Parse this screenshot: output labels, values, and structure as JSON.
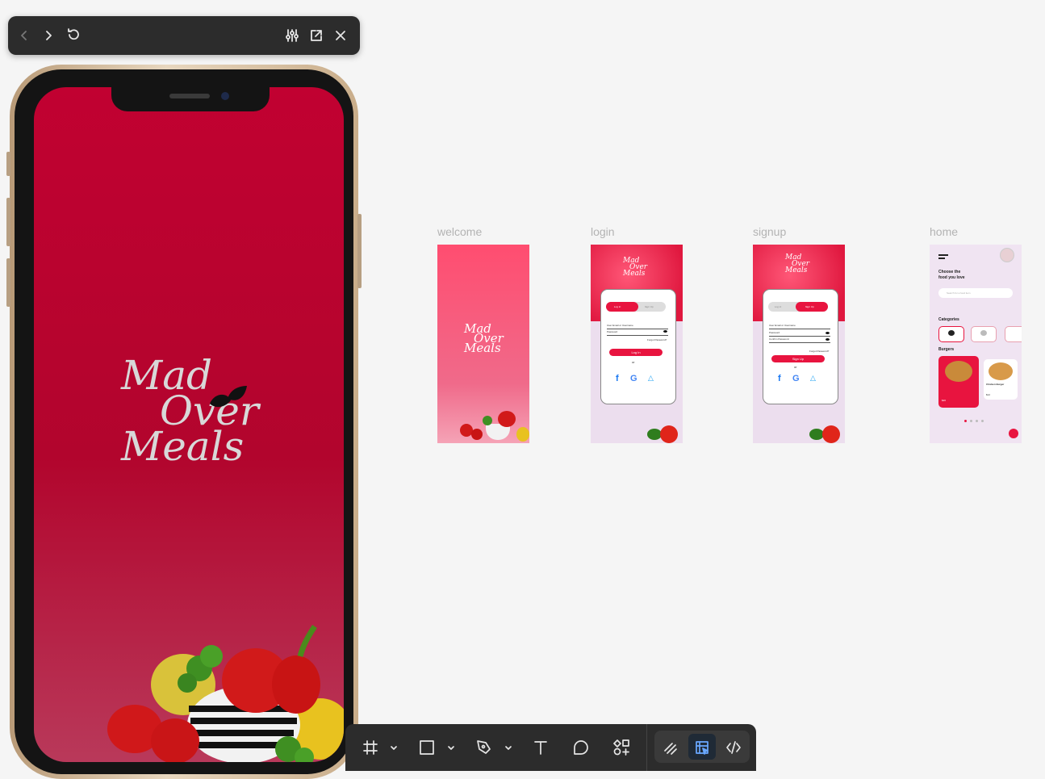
{
  "prototype_toolbar": {
    "back": "back-icon",
    "forward": "forward-icon",
    "restart": "restart-icon",
    "settings": "settings-icon",
    "open_new": "open-new-icon",
    "close": "close-icon"
  },
  "phone_preview": {
    "logo_line1": "Mad",
    "logo_line2": "Over",
    "logo_line3": "Meals"
  },
  "frames": [
    {
      "label": "welcome"
    },
    {
      "label": "login"
    },
    {
      "label": "signup"
    },
    {
      "label": "home"
    }
  ],
  "login_frame": {
    "tab_login": "Log In",
    "tab_signup": "Sign Up",
    "field_user": "User Email or Username",
    "field_password": "Password",
    "forgot": "Forgot Password?",
    "button": "Log In",
    "or": "or"
  },
  "signup_frame": {
    "tab_login": "Log In",
    "tab_signup": "Sign Up",
    "field_user": "User Email or Username",
    "field_password": "Password",
    "field_confirm": "Confirm Password",
    "button": "Sign Up",
    "or": "or"
  },
  "home_frame": {
    "heading1": "Choose the",
    "heading2": "food you love",
    "search_placeholder": "Search for a food item",
    "categories": "Categories",
    "burgers": "Burgers",
    "item2": "Chicken Burger",
    "price2": "$12"
  },
  "colors": {
    "brand": "#e8143f",
    "screen": "#b2052d"
  }
}
